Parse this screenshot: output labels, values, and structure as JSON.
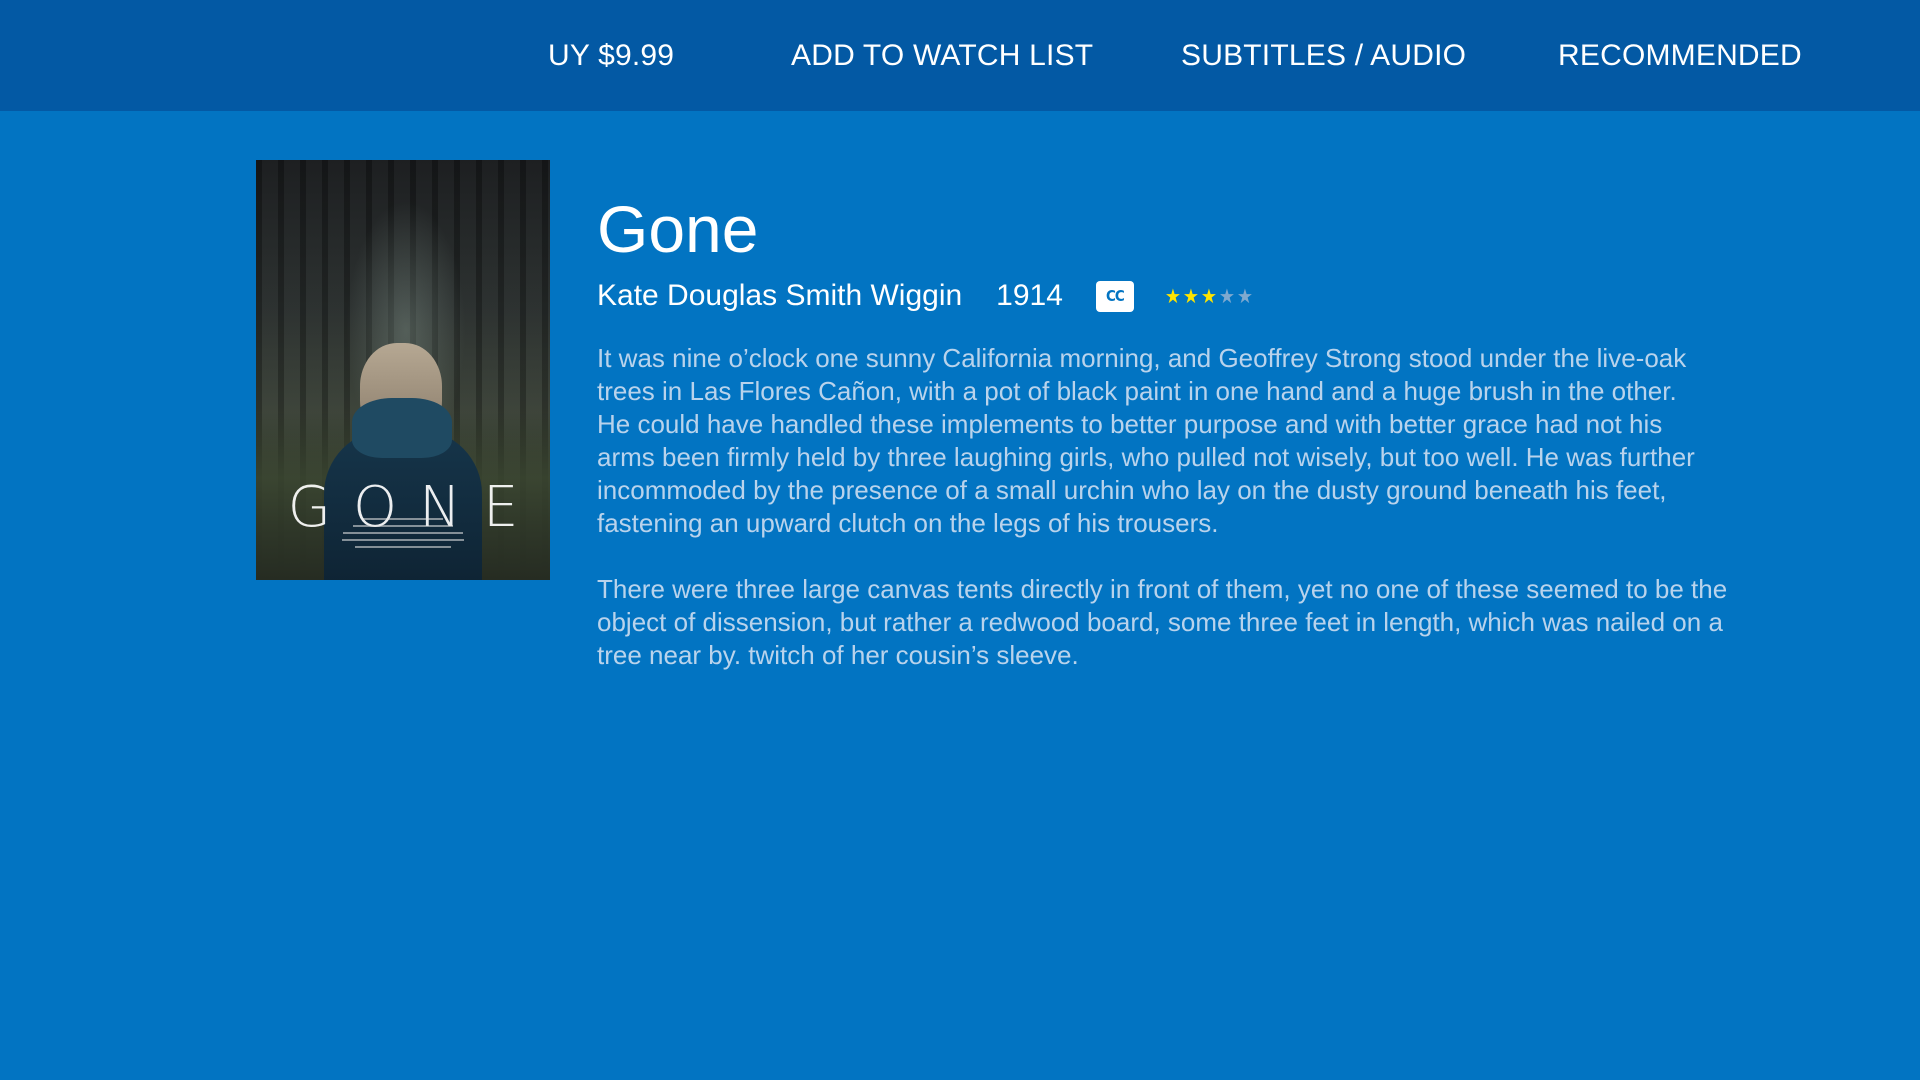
{
  "nav": {
    "buy_label": "UY $9.99",
    "watchlist_label": "ADD TO WATCH LIST",
    "subtitles_label": "SUBTITLES / AUDIO",
    "recommended_label": "RECOMMENDED"
  },
  "poster": {
    "title_text": "GONE"
  },
  "movie": {
    "title": "Gone",
    "author": "Kate Douglas Smith Wiggin",
    "year": "1914",
    "cc_label": "CC",
    "rating": {
      "value": 3,
      "max": 5
    },
    "description": [
      "It was nine o’clock one sunny California morning, and Geoffrey Strong stood under the live-oak\ntrees in Las Flores Cañon, with a pot of black paint in one hand and a huge brush in the other.\nHe could have handled these implements to better purpose and with better grace had not his\narms been firmly held by three laughing girls, who pulled not wisely, but too well.  He was further\nincommoded by the presence of a small urchin who lay on the dusty ground beneath his feet,\nfastening an upward clutch on the legs of his trousers.",
      "There were three large canvas tents directly in front of them, yet no one of these seemed to be the\nobject of dissension, but rather a redwood board, some three feet in length, which was nailed on a\ntree near by. twitch of her cousin’s sleeve."
    ]
  },
  "colors": {
    "background": "#0274c2",
    "topbar": "#0359a4",
    "star_on": "#ffe500",
    "star_off": "#7fa9cf",
    "description_text": "#b9d3ec"
  }
}
